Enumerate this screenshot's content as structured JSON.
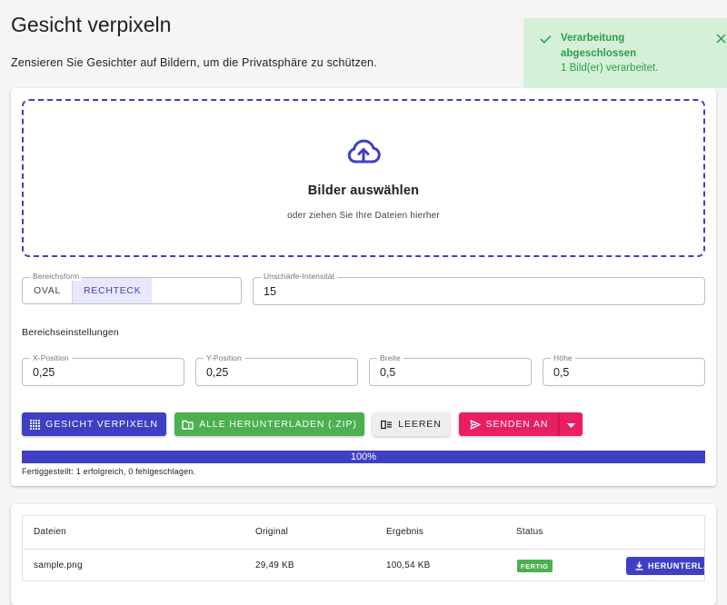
{
  "header": {
    "title": "Gesicht verpixeln",
    "subtitle": "Zensieren Sie Gesichter auf Bildern, um die Privatsphäre zu schützen."
  },
  "dropzone": {
    "title": "Bilder auswählen",
    "hint": "oder ziehen Sie Ihre Dateien hierher",
    "icon": "cloud-upload-icon"
  },
  "area_shape": {
    "label": "Bereichsform",
    "options": [
      "OVAL",
      "RECHTECK"
    ],
    "selected": "RECHTECK"
  },
  "blur": {
    "label": "Unschärfe-Intensität",
    "value": "15"
  },
  "area_settings": {
    "heading": "Bereichseinstellungen",
    "fields": [
      {
        "label": "X-Position",
        "value": "0,25"
      },
      {
        "label": "Y-Position",
        "value": "0,25"
      },
      {
        "label": "Breite",
        "value": "0,5"
      },
      {
        "label": "Höhe",
        "value": "0,5"
      }
    ]
  },
  "actions": {
    "pixelate": "GESICHT VERPIXELN",
    "download_all": "ALLE HERUNTERLADEN (.ZIP)",
    "clear": "LEEREN",
    "send_to": "SENDEN AN"
  },
  "progress": {
    "percent": 100,
    "label": "100%",
    "status": "Fertiggestellt: 1 erfolgreich, 0 fehlgeschlagen."
  },
  "files_table": {
    "columns": [
      "Dateien",
      "Original",
      "Ergebnis",
      "Status"
    ],
    "rows": [
      {
        "file": "sample.png",
        "original": "29,49 KB",
        "result": "100,54 KB",
        "status": "FERTIG",
        "action": "HERUNTERLADEN"
      }
    ]
  },
  "toast": {
    "title": "Verarbeitung abgeschlossen",
    "message": "1 Bild(er) verarbeitet."
  },
  "colors": {
    "primary": "#3f3fc4",
    "success": "#4caf50",
    "pink": "#e91e63",
    "toast_bg": "#d4f0d9",
    "toast_text": "#2e9e4a"
  }
}
